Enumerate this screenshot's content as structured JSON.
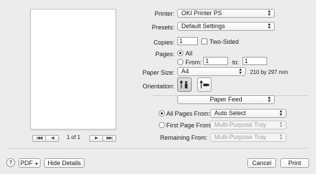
{
  "preview": {
    "page_indicator": "1 of 1",
    "nav": {
      "first": "|◀◀",
      "prev": "◀",
      "next": "▶",
      "last": "▶▶|"
    }
  },
  "printer": {
    "label": "Printer:",
    "value": "OKI Printer PS"
  },
  "presets": {
    "label": "Presets:",
    "value": "Default Settings"
  },
  "copies": {
    "label": "Copies:",
    "value": "1",
    "two_sided_label": "Two-Sided",
    "two_sided_checked": false
  },
  "pages": {
    "label": "Pages:",
    "all_label": "All",
    "from_label": "From:",
    "from_value": "1",
    "to_label": "to:",
    "to_value": "1",
    "selected": "All"
  },
  "paper_size": {
    "label": "Paper Size:",
    "value": "A4",
    "dimensions": "210 by 297 mm"
  },
  "orientation": {
    "label": "Orientation:",
    "selected": "portrait"
  },
  "section": {
    "value": "Paper Feed"
  },
  "paper_feed": {
    "all_pages_label": "All Pages From:",
    "all_pages_value": "Auto Select",
    "first_page_label": "First Page From:",
    "first_page_value": "Multi-Purpose Tray",
    "remaining_label": "Remaining From:",
    "remaining_value": "Multi-Purpose Tray",
    "selected": "All Pages From"
  },
  "footer": {
    "help": "?",
    "pdf": "PDF",
    "hide_details": "Hide Details",
    "cancel": "Cancel",
    "print": "Print"
  }
}
